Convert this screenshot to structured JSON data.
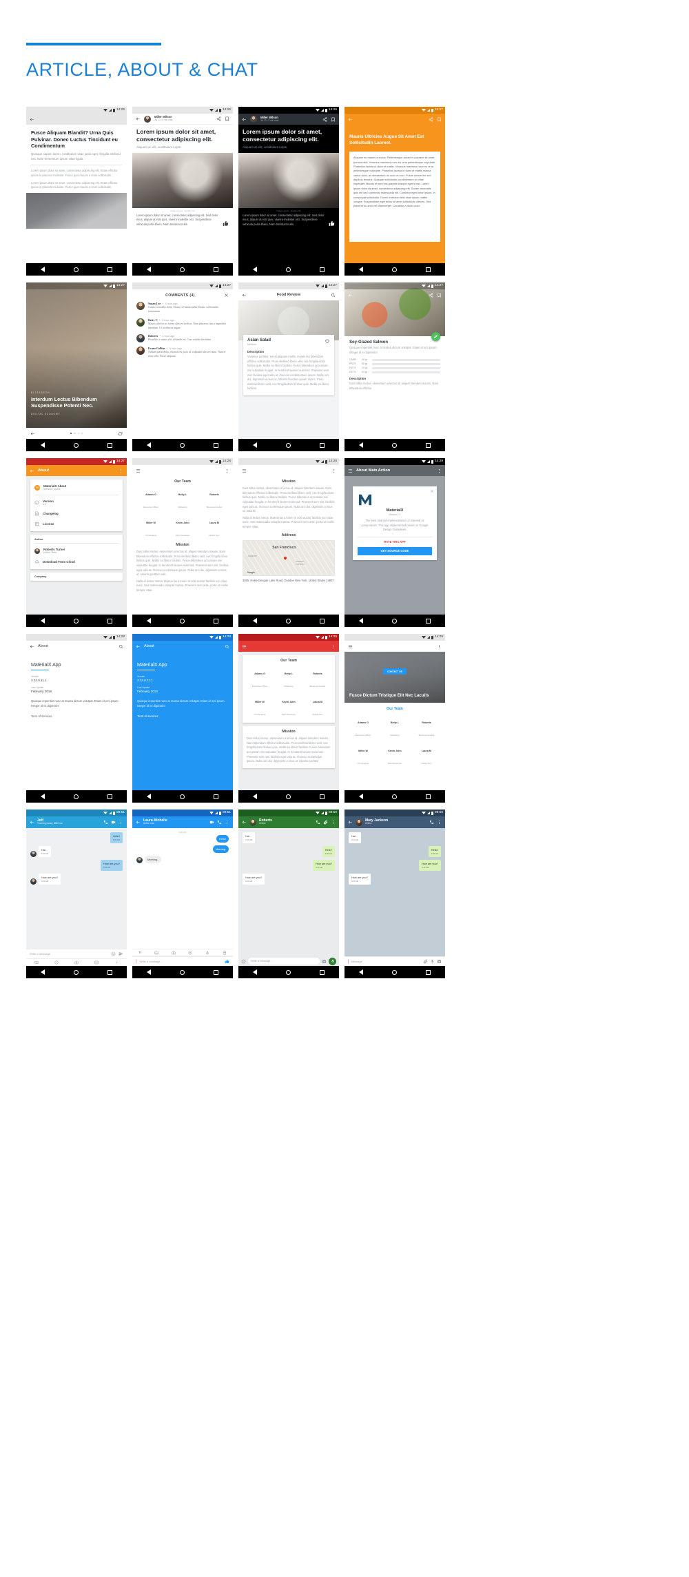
{
  "header": {
    "title": "ARTICLE, ABOUT & CHAT",
    "accent": "#1b7fd4"
  },
  "screens": {
    "s1": {
      "name": "article-plain",
      "time": "14:26",
      "title": "Fusce Aliquam Blandit? Urna Quis Pulvinar. Donec Luctus Tincidunt eu Condimentum",
      "lead": "Quisque sapien lorem, vestibulum vitae justo eget, fringilla eleifend nisi. Nam fermentum ipsum vitae ligula",
      "body1": "Lorem ipsum dolor sit amet, consectetur adipiscing elit. Etiam efficitur ipsum in placerat molestie. Fusce quis mauris a enim sollicitudin",
      "body2": "Lorem ipsum dolor sit amet, consectetur adipiscing elit. Etiam efficitur ipsum in placerat molestie. Fusce quis mauris a enim sollicitudin"
    },
    "s2": {
      "name": "article-author-light",
      "time": "14:26",
      "author": "Miller Wilson",
      "meta": "Jul 13  •  5 min read",
      "title": "Lorem ipsum dolor sit amet, consectetur adipiscing elit.",
      "subtitle": "Aliquam ac elit, vestibulum turpis.",
      "caption": "Image source : pexels.com",
      "body": "Lorem ipsum dolor sit amet, consectetur adipiscing elit. Sed dolor risus, aliquet at erat quis, viverra molestie orci. Suspendisse vehicula porta libero. Nam tincidunt nulla"
    },
    "s3": {
      "name": "article-author-dark",
      "time": "14:26",
      "author": "Miller Wilson",
      "meta": "Jul 13  •  5 min read",
      "title": "Lorem ipsum dolor sit amet, consectetur adipiscing elit.",
      "subtitle": "Aliquam ac elit, vestibulum turpis.",
      "caption": "Image source : pexels.com",
      "body": "Lorem ipsum dolor sit amet, consectetur adipiscing elit. Sed dolor risus, aliquet at erat quis, viverra molestie orci. Suspendisse vehicula porta libero. Nam tincidunt nulla"
    },
    "s4": {
      "name": "article-orange-card",
      "time": "14:27",
      "accent": "#F7941E",
      "title": "Mauris Ultricies Augue Sit Amet Est Sollicitudin Laoreet.",
      "body": "Aliquam eu mauris a lectus. Pellentesque auctor in posuere sit amet, porta a nibh. Vivamus maximus nunc eu urna pellentesque vulputate. Phasellus lacinia ut diam et mattis. Vivamus maximus nunc eu urna pellentesque vulputate. Phasellus lacinia ut diam et mattis massa varius dolor, ac elementum mi nunc eu orci. Fusce ornare leo sed dapibus tempus. Quisque sollicitudin condimentum ex vitae imperdiet. Mauris et sem nisl gravida suscipit eget id est. Lorem ipsum dolor sit amet, consectetur adipiscing elit. Donec venenatis quis elit sed commodo malesuada elit. Curabitur eget tortor ipsum. In consequat sollicitudin. Donec interdum felis vitae ipsum mattis congue. Suspendisse eget tellus sit amet sollicitudin ultrices. Sed placerat eu arcu vel ullamcorper. Curabitur a dolor dolor."
    },
    "s5": {
      "name": "article-hero-overlay",
      "time": "14:27",
      "kicker": "ELIZABETH",
      "title": "Interdum Lectus Bibendum Suspendisse Potenti Nec.",
      "tag": "DIGITAL ECONOMY"
    },
    "s6": {
      "name": "comments-sheet",
      "time": "14:27",
      "heading": "COMMENTS (4)",
      "items": [
        {
          "name": "Susan Lee",
          "time": "3 hour ago",
          "text": "Cursus convallis dolor. Etiam vel lacinia nibh. Donec sollicitudin fermentum"
        },
        {
          "name": "Betty C",
          "time": "3 hour ago",
          "text": "Mauris ultrices ac lorem ultrices facilisis. Nam pharetra, nisi a imperdiet interdum. Ut ut ultrices augue"
        },
        {
          "name": "Roberts",
          "time": "4 hour ago",
          "text": "Phasellus a varius elit, a blandit est. Cras sodales tincidunt"
        },
        {
          "name": "Evans Collins",
          "time": "5 hour ago",
          "text": "Nullam purus dolor, rhoncus eu justo id, vulputate ultrices nunc. Nam et risus velit. Fusce aliquam."
        }
      ]
    },
    "s7": {
      "name": "food-review-detail",
      "time": "14:27",
      "appbar": "Food Review",
      "dish": "Asian Salad",
      "level": "Medium",
      "desc_label": "Description",
      "desc": "Vivamus porttitor, est at aliquam mollis, mauris leo bibendum efficitur sollicitudin. Proin eleifend libero velit, nec fringilla dolor finibus quis. Mollis eu libero facilisis. Fusce bibendum accumsan nisi vulputate feugiat. In hendrerit laoreet euismod. Praesent sem nisl, facilisis eget odio at, rhoncus condimentum ipsum. Nulla orci dui, dignissim a risus ut, lobortis faucibus ipsum donec. Proin eleifend libero velit, nec fringilla dolor finibus quis. Mollis eu libero facilisis"
    },
    "s8": {
      "name": "food-nutrition-detail",
      "time": "14:27",
      "dish": "Soy-Glazed Salmon",
      "dish_sub": "Quisque imperdiet nunc at massa dictum volutpat. Etiam id orci ipsum. Integer id ex dignissim",
      "nutrition": [
        {
          "label": "CARB",
          "value": "40 gr",
          "pct": 62
        },
        {
          "label": "PROT",
          "value": "80 gr",
          "pct": 78
        },
        {
          "label": "FAT S",
          "value": "10 gr",
          "pct": 30
        },
        {
          "label": "FAT U",
          "value": "34 gr",
          "pct": 48
        }
      ],
      "desc_label": "Description",
      "desc": "Duis tellus metus, elementum a lectus id, aliquet interdum mauris. Nam bibendum efficitur"
    },
    "s9": {
      "name": "about-list",
      "time": "14:27",
      "appbar": "About",
      "accent": "#F7941E",
      "app_name": "MaterialX About",
      "app_handle": "@dream_space",
      "items": [
        {
          "label": "Version",
          "sub": "4.0"
        },
        {
          "label": "Changelog",
          "sub": ""
        },
        {
          "label": "License",
          "sub": ""
        }
      ],
      "author_label": "Author",
      "author_name": "Roberts Turner",
      "author_sub": "United State",
      "download": "Download From Cloud",
      "company_label": "Company"
    },
    "s10": {
      "name": "about-team-mission",
      "time": "14:28",
      "team_title": "Our Team",
      "team": [
        {
          "name": "Adams G",
          "role": "Executive Officer"
        },
        {
          "name": "Betty L",
          "role": "Marketing"
        },
        {
          "name": "Roberts",
          "role": "Business Analyst"
        },
        {
          "name": "Miller W",
          "role": "UX Designer"
        },
        {
          "name": "Kevin John",
          "role": "Web Developer"
        },
        {
          "name": "Laura M",
          "role": "Mobile Dev"
        }
      ],
      "mission_title": "Mission",
      "mission": "Duis tellus metus, elementum a lectus id, aliquet interdum mauris. Nam bibendum efficitur sollicitudin. Proin eleifend libero velit, nec fringilla dolor finibus quis. Mollis eu libero facilisis. Fusce bibendum accumsan nisi vulputate feugiat. In hendrerit laoreet euismod. Praesent sem nisl, facilisis eget odio at, rhoncus scelerisque ipsum. Nulla orci dui, dignissim a risus ut, lobortis porttitor velit.",
      "mission2": "Nulla id lectus metus. Maecenas a lorem in odio auctor facilisis non vitae nunc. Sed malesuada volutpat massa. Praesent sem ante, porta ut mollis tempor vitae."
    },
    "s11": {
      "name": "about-mission-address",
      "time": "14:28",
      "mission_title": "Mission",
      "mission": "Duis tellus metus, elementum a lectus id, aliquet interdum mauris. Nam bibendum efficitur sollicitudin. Proin eleifend libero velit, nec fringilla dolor finibus quis. Mollis eu libero facilisis. Fusce bibendum accumsan nisi vulputate feugiat. In hendrerit laoreet euismod. Praesent sem nisl, facilisis eget odio at, rhoncus scelerisque ipsum. Nulla orci dui, dignissim a risus ut, lobortis",
      "mission2": "Nulla id lectus metus. Maecenas a lorem in odio auctor facilisis non vitae nunc. Sed malesuada volutpat massa. Praesent sem ante, porta ut mollis tempor vitae.",
      "address_title": "Address",
      "map_city": "San Francisco",
      "map_labels": [
        "ASHBURY",
        "MISSION DISTRICT",
        "Google"
      ],
      "address": "3265. Heike Deegan Lake Road, Dundee New York, United States 14837"
    },
    "s12": {
      "name": "about-main-action",
      "time": "14:29",
      "appbar": "About Main Action",
      "card_title": "MaterialX",
      "card_ver": "Version 2.1",
      "card_desc": "The best android implementation of material UI components. This app implemented based on Google Design Guidelines.",
      "rate": "RATE THIS APP",
      "source": "GET SOURCE CODE"
    },
    "s13": {
      "name": "about-simple-light",
      "time": "14:28",
      "appbar": "About",
      "app_title": "MaterialX App",
      "version_label": "Version",
      "version": "3.24.0.11.1",
      "update_label": "Last Update",
      "update": "February 2018",
      "desc": "Quisque imperdiet nunc at massa dictum volutpat. Etiam id orci ipsum. Integer id ex dignissim",
      "terms": "Term of services"
    },
    "s14": {
      "name": "about-simple-blue",
      "time": "14:28",
      "accent": "#2196F3",
      "appbar": "About",
      "app_title": "MaterialX App",
      "version_label": "Version",
      "version": "3.24.0.11.1",
      "update_label": "Last Update",
      "update": "February 2018",
      "desc": "Quisque imperdiet nunc at massa dictum volutpat. Etiam id orci ipsum. Integer id ex dignissim",
      "terms": "Term of services"
    },
    "s15": {
      "name": "about-team-red",
      "time": "14:29",
      "accent": "#E53935",
      "team_title": "Our Team",
      "team": [
        {
          "name": "Adams G",
          "role": "Executive Officer"
        },
        {
          "name": "Betty L",
          "role": "Marketing"
        },
        {
          "name": "Roberts",
          "role": "Business Analyst"
        },
        {
          "name": "Miller W",
          "role": "UX Designer"
        },
        {
          "name": "Kevin John",
          "role": "Web Developer"
        },
        {
          "name": "Laura M",
          "role": "Mobile Dev"
        }
      ],
      "mission_title": "Mission",
      "mission": "Duis tellus metus, elementum a lectus id, aliquet interdum mauris. Nam bibendum efficitur sollicitudin. Proin eleifend libero velit, nec fringilla dolor finibus quis. Mollis eu libero facilisis. Fusce bibendum accumsan nisi vulputate feugiat. In hendrerit laoreet euismod. Praesent sem nisl, facilisis eget odio at, rhoncus scelerisque ipsum. Nulla orci dui, dignissim a risus ut, lobortis porttitor"
    },
    "s16": {
      "name": "about-hero-contact",
      "time": "14:28",
      "contact_btn": "CONTACT US",
      "hero_title": "Fusce Dictum Tristique Elit Nec Lacuiis",
      "team_title": "Our Team",
      "team": [
        {
          "name": "Adams G",
          "role": "Executive Officer"
        },
        {
          "name": "Betty L",
          "role": "Marketing"
        },
        {
          "name": "Roberts",
          "role": "Business Analyst"
        },
        {
          "name": "Miller W",
          "role": "UX Designer"
        },
        {
          "name": "Kevin John",
          "role": "Web Developer"
        },
        {
          "name": "Laura M",
          "role": "Mobile Dev"
        }
      ]
    },
    "s17": {
      "name": "chat-jeff",
      "time": "09:51",
      "accent": "#29A3DC",
      "contact": "Jeff",
      "status": "Traveling today, BBM me.",
      "messages": [
        {
          "side": "right",
          "text": "Hello!",
          "time": "9:30 AM"
        },
        {
          "side": "left",
          "text": "Hai...",
          "time": "9:30 AM"
        },
        {
          "side": "right",
          "text": "How are you?",
          "time": "9:30 AM"
        },
        {
          "side": "left",
          "text": "How are you?",
          "time": "9:30 AM"
        }
      ],
      "input_placeholder": "Write a message"
    },
    "s18": {
      "name": "chat-laura",
      "time": "09:51",
      "accent": "#2196F3",
      "contact": "Laura Michelle",
      "status": "Active now",
      "day": "9:30 AM",
      "messages": [
        {
          "side": "right",
          "text": "Hello!",
          "time": ""
        },
        {
          "side": "right",
          "text": "Morning.",
          "time": ""
        },
        {
          "side": "left",
          "text": "Morning..",
          "time": ""
        }
      ],
      "input_placeholder": "Write a message..."
    },
    "s19": {
      "name": "chat-roberts",
      "time": "09:50",
      "accent": "#2E7D32",
      "contact": "Roberts",
      "status": "Online",
      "messages": [
        {
          "side": "left",
          "text": "Hai...",
          "time": "9:30 AM"
        },
        {
          "side": "right",
          "text": "Hello!",
          "time": "9:30 AM"
        },
        {
          "side": "right",
          "text": "How are you?",
          "time": "9:30 AM"
        },
        {
          "side": "left",
          "text": "How are you?",
          "time": "9:30 AM"
        }
      ],
      "input_placeholder": "Write a message..."
    },
    "s20": {
      "name": "chat-mary",
      "time": "09:50",
      "accent": "#3F5B78",
      "contact": "Mary Jackson",
      "status": "Online",
      "messages": [
        {
          "side": "left",
          "text": "Hai...",
          "time": "9:30 AM"
        },
        {
          "side": "right",
          "text": "Hello!",
          "time": "9:30 AM"
        },
        {
          "side": "right",
          "text": "How are you?",
          "time": "9:30 AM"
        },
        {
          "side": "left",
          "text": "How are you?",
          "time": "9:30 AM"
        }
      ],
      "input_placeholder": "Message"
    }
  }
}
